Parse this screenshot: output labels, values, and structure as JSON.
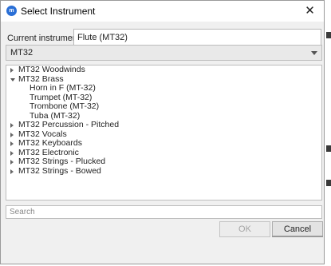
{
  "window": {
    "title": "Select Instrument",
    "app_icon_label": "m"
  },
  "current_instrument": {
    "label": "Current instrument:",
    "value": "Flute (MT32)"
  },
  "instrument_set": {
    "selected": "MT32"
  },
  "tree": {
    "categories": [
      {
        "label": "MT32 Woodwinds",
        "expanded": false,
        "children": []
      },
      {
        "label": "MT32 Brass",
        "expanded": true,
        "children": [
          "Horn in F (MT-32)",
          "Trumpet (MT-32)",
          "Trombone (MT-32)",
          "Tuba (MT-32)"
        ]
      },
      {
        "label": "MT32 Percussion - Pitched",
        "expanded": false,
        "children": []
      },
      {
        "label": "MT32 Vocals",
        "expanded": false,
        "children": []
      },
      {
        "label": "MT32 Keyboards",
        "expanded": false,
        "children": []
      },
      {
        "label": "MT32 Electronic",
        "expanded": false,
        "children": []
      },
      {
        "label": "MT32 Strings - Plucked",
        "expanded": false,
        "children": []
      },
      {
        "label": "MT32 Strings - Bowed",
        "expanded": false,
        "children": []
      }
    ]
  },
  "search": {
    "placeholder": "Search",
    "value": ""
  },
  "buttons": {
    "ok_label": "OK",
    "ok_enabled": false,
    "cancel_label": "Cancel"
  },
  "icons": {
    "close": "close-icon",
    "dropdown": "chevron-down-icon",
    "collapsed": "triangle-right-icon",
    "expanded": "triangle-down-icon"
  }
}
